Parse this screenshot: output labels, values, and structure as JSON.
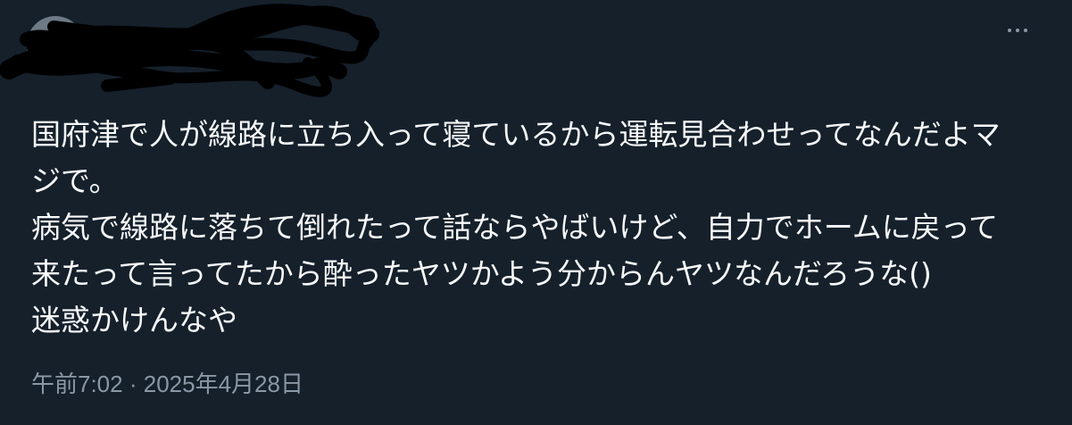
{
  "header": {
    "display_name": "",
    "handle": "",
    "avatar_icon": "user-avatar",
    "more_icon": "more-horizontal-icon"
  },
  "tweet": {
    "lines": [
      "国府津で人が線路に立ち入って寝ているから運転見合わせってなんだよマ",
      "ジで。",
      "病気で線路に落ちて倒れたって話ならやばいけど、自力でホームに戻って",
      "来たって言ってたから酔ったヤツかよう分からんヤツなんだろうな()",
      "迷惑かけんなや"
    ]
  },
  "meta": {
    "time": "午前7:02",
    "separator": "·",
    "date": "2025年4月28日"
  },
  "colors": {
    "background": "#15202b",
    "text_primary": "#f7f9f9",
    "text_secondary": "#8b98a5"
  }
}
